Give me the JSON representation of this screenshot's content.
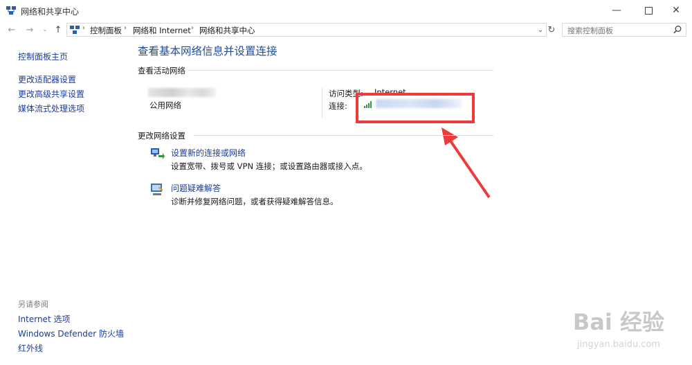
{
  "window": {
    "title": "网络和共享中心",
    "minimize_icon": "minimize-icon",
    "maximize_icon": "maximize-icon",
    "close_icon": "close-icon"
  },
  "address_bar": {
    "breadcrumbs": [
      "控制面板",
      "网络和 Internet",
      "网络和共享中心"
    ],
    "search_placeholder": "搜索控制面板"
  },
  "sidebar": {
    "home": "控制面板主页",
    "links": [
      "更改适配器设置",
      "更改高级共享设置",
      "媒体流式处理选项"
    ],
    "see_also_title": "另请参阅",
    "see_also": [
      "Internet 选项",
      "Windows Defender 防火墙",
      "红外线"
    ]
  },
  "main": {
    "title": "查看基本网络信息并设置连接",
    "active_networks_header": "查看活动网络",
    "network_type": "公用网络",
    "access_type_label": "访问类型:",
    "access_type_value": "Internet",
    "connection_label": "连接:",
    "change_settings_header": "更改网络设置",
    "tasks": [
      {
        "title": "设置新的连接或网络",
        "desc": "设置宽带、拨号或 VPN 连接；或设置路由器或接入点。"
      },
      {
        "title": "问题疑难解答",
        "desc": "诊断并修复网络问题，或者获得疑难解答信息。"
      }
    ]
  },
  "watermark": {
    "brand": "Bai 经验",
    "url": "jingyan.baidu.com"
  },
  "colors": {
    "link": "#1a3c9c",
    "title": "#1e4e9c",
    "annotation": "#ee3a3a"
  }
}
